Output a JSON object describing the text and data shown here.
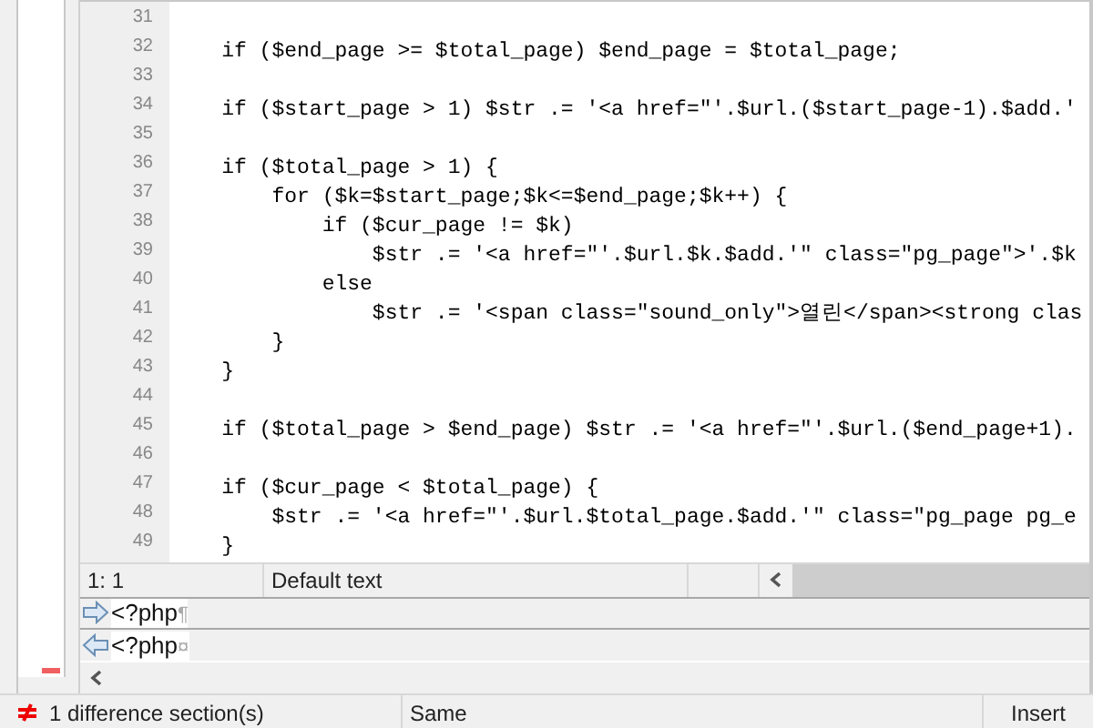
{
  "editor": {
    "lines": [
      {
        "number": "31"
      },
      {
        "number": "32",
        "code": "    if ($end_page >= $total_page) $end_page = $total_page;"
      },
      {
        "number": "33"
      },
      {
        "number": "34",
        "code": "    if ($start_page > 1) $str .= '<a href=\"'.$url.($start_page-1).$add.'"
      },
      {
        "number": "35"
      },
      {
        "number": "36",
        "code": "    if ($total_page > 1) {"
      },
      {
        "number": "37",
        "code": "        for ($k=$start_page;$k<=$end_page;$k++) {"
      },
      {
        "number": "38",
        "code": "            if ($cur_page != $k)"
      },
      {
        "number": "39",
        "code": "                $str .= '<a href=\"'.$url.$k.$add.'\" class=\"pg_page\">'.$k"
      },
      {
        "number": "40",
        "code": "            else"
      },
      {
        "number": "41",
        "code": "                $str .= '<span class=\"sound_only\">열린</span><strong clas"
      },
      {
        "number": "42",
        "code": "        }"
      },
      {
        "number": "43",
        "code": "    }"
      },
      {
        "number": "44"
      },
      {
        "number": "45",
        "code": "    if ($total_page > $end_page) $str .= '<a href=\"'.$url.($end_page+1)."
      },
      {
        "number": "46"
      },
      {
        "number": "47",
        "code": "    if ($cur_page < $total_page) {"
      },
      {
        "number": "48",
        "code": "        $str .= '<a href=\"'.$url.$total_page.$add.'\" class=\"pg_page pg_e"
      },
      {
        "number": "49",
        "code": "    }"
      }
    ]
  },
  "pane_status": {
    "position": "1: 1",
    "syntax": "Default text"
  },
  "diff_detail": [
    {
      "kind": "left",
      "text": "<?php",
      "eol": "¶"
    },
    {
      "kind": "right",
      "text": "<?php",
      "eol": "¤"
    }
  ],
  "status_bar": {
    "differences": "1 difference section(s)",
    "comparison": "Same",
    "mode": "Insert"
  }
}
